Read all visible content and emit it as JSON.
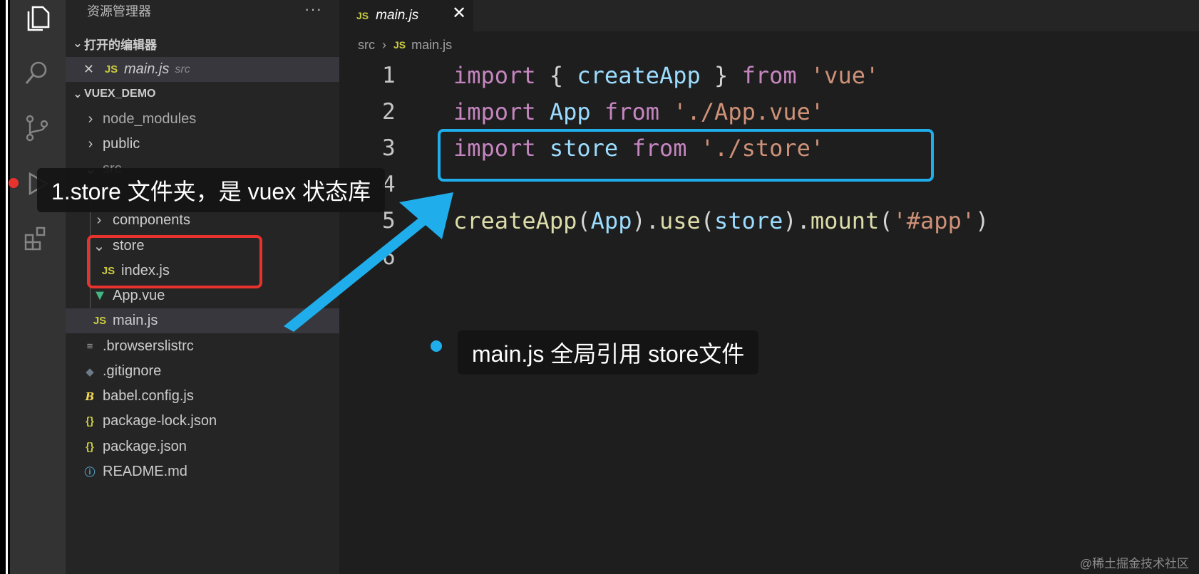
{
  "sidebar": {
    "title": "资源管理器",
    "more": "···",
    "open_editors_header": "打开的编辑器",
    "open_editor": {
      "name": "main.js",
      "dir": "src"
    },
    "project_header": "VUEX_DEMO",
    "tree": {
      "node_modules": "node_modules",
      "public": "public",
      "src": "src",
      "components": "components",
      "store": "store",
      "index_js": "index.js",
      "app_vue": "App.vue",
      "main_js": "main.js",
      "browserslistrc": ".browserslistrc",
      "gitignore": ".gitignore",
      "babel_config": "babel.config.js",
      "package_lock": "package-lock.json",
      "package_json": "package.json",
      "readme": "README.md"
    },
    "icon_labels": {
      "js": "JS",
      "json": "{}"
    }
  },
  "editor": {
    "tab": {
      "label": "main.js",
      "close": "✕"
    },
    "breadcrumb": {
      "folder": "src",
      "file": "main.js"
    },
    "line_numbers": [
      "1",
      "2",
      "3",
      "4",
      "5",
      "6"
    ],
    "lines": [
      [
        {
          "t": "import",
          "c": "kw"
        },
        {
          "t": " { ",
          "c": "pl"
        },
        {
          "t": "createApp",
          "c": "var"
        },
        {
          "t": " } ",
          "c": "pl"
        },
        {
          "t": "from",
          "c": "kw"
        },
        {
          "t": " ",
          "c": "pl"
        },
        {
          "t": "'vue'",
          "c": "str"
        }
      ],
      [
        {
          "t": "import",
          "c": "kw"
        },
        {
          "t": " ",
          "c": "pl"
        },
        {
          "t": "App",
          "c": "var"
        },
        {
          "t": " ",
          "c": "pl"
        },
        {
          "t": "from",
          "c": "kw"
        },
        {
          "t": " ",
          "c": "pl"
        },
        {
          "t": "'./App.vue'",
          "c": "str"
        }
      ],
      [
        {
          "t": "import",
          "c": "kw"
        },
        {
          "t": " ",
          "c": "pl"
        },
        {
          "t": "store",
          "c": "var"
        },
        {
          "t": " ",
          "c": "pl"
        },
        {
          "t": "from",
          "c": "kw"
        },
        {
          "t": " ",
          "c": "pl"
        },
        {
          "t": "'./store'",
          "c": "str"
        }
      ],
      [],
      [
        {
          "t": "createApp",
          "c": "fn"
        },
        {
          "t": "(",
          "c": "pl"
        },
        {
          "t": "App",
          "c": "var"
        },
        {
          "t": ").",
          "c": "pl"
        },
        {
          "t": "use",
          "c": "fn"
        },
        {
          "t": "(",
          "c": "pl"
        },
        {
          "t": "store",
          "c": "var"
        },
        {
          "t": ").",
          "c": "pl"
        },
        {
          "t": "mount",
          "c": "fn"
        },
        {
          "t": "(",
          "c": "pl"
        },
        {
          "t": "'#app'",
          "c": "str"
        },
        {
          "t": ")",
          "c": "pl"
        }
      ],
      []
    ]
  },
  "annotations": {
    "callout_store": "1.store 文件夹，是 vuex 状态库",
    "callout_main": "main.js 全局引用 store文件"
  },
  "watermark": "@稀土掘金技术社区",
  "colors": {
    "blue_box": "#1faeeb",
    "red_box": "#e8332d",
    "keyword": "#c586c0",
    "variable": "#9cdcfe",
    "string": "#ce9178",
    "function": "#dcdcaa"
  }
}
